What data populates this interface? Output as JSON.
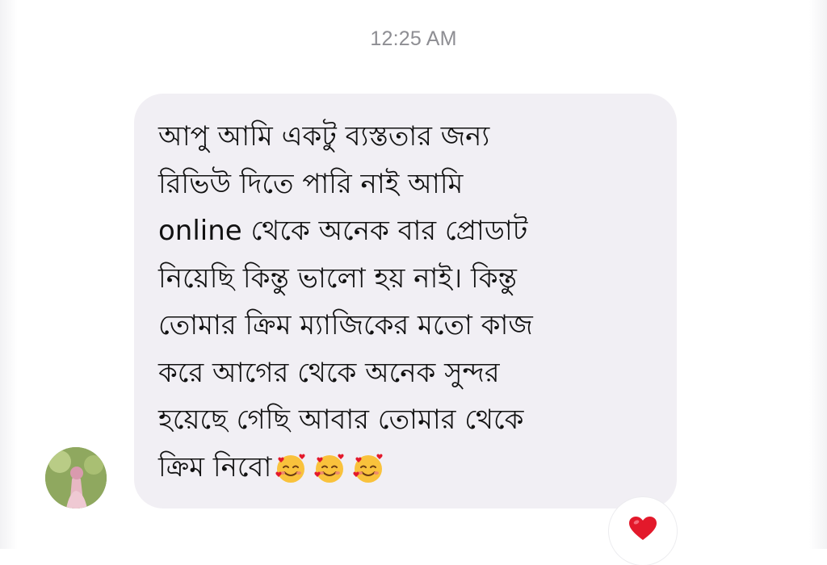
{
  "chat": {
    "timestamp": "12:25 AM",
    "message": {
      "lines": [
        "আপু আমি একটু ব্যস্ততার জন্য",
        "রিভিউ দিতে পারি নাই  আমি",
        "online থেকে অনেক বার প্রোডাট",
        "নিয়েছি কিন্তু ভালো হয় নাই। কিন্তু",
        "তোমার  ক্রিম ম্যাজিকের মতো কাজ",
        "করে আগের থেকে অনেক সুন্দর",
        "হয়েছে গেছি আবার  তোমার থেকে",
        "ক্রিম নিবো"
      ],
      "emojis": [
        "smiling-face-with-hearts-icon",
        "smiling-face-with-hearts-icon",
        "smiling-face-with-hearts-icon"
      ],
      "reaction": "red-heart-icon"
    }
  },
  "colors": {
    "bubble": "#f1eff4",
    "text": "#111111",
    "timestamp": "#8e8e93",
    "heart": "#e3192b"
  }
}
